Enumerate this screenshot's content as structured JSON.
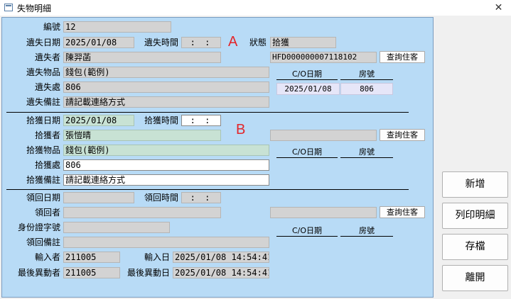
{
  "window": {
    "title": "失物明細",
    "close_glyph": "✕"
  },
  "markers": {
    "a": "A",
    "b": "B"
  },
  "lost": {
    "id_label": "編號",
    "id_value": "12",
    "date_label": "遺失日期",
    "date_value": "2025/01/08",
    "time_label": "遺失時間",
    "time_value": ":  :",
    "status_label": "狀態",
    "status_value": "拾獲",
    "person_label": "遺失者",
    "person_value": "陳羿菡",
    "reg_value": "HFD000000007118102",
    "lookup_label": "查詢住客",
    "item_label": "遺失物品",
    "item_value": "錢包(範例)",
    "place_label": "遺失處",
    "place_value": "806",
    "note_label": "遺失備註",
    "note_value": "請記載連絡方式",
    "table": {
      "col1": "C/O日期",
      "col2": "房號",
      "row_co": "2025/01/08",
      "row_room": "806"
    }
  },
  "found": {
    "date_label": "拾獲日期",
    "date_value": "2025/01/08",
    "time_label": "拾獲時間",
    "time_value": ":  :",
    "person_label": "拾獲者",
    "person_value": "張愷晴",
    "reg_value": "",
    "lookup_label": "查詢住客",
    "item_label": "拾獲物品",
    "item_value": "錢包(範例)",
    "place_label": "拾獲處",
    "place_value": "806",
    "note_label": "拾獲備註",
    "note_value": "請記載連絡方式",
    "table": {
      "col1": "C/O日期",
      "col2": "房號"
    }
  },
  "returned": {
    "date_label": "領回日期",
    "date_value": "",
    "time_label": "領回時間",
    "time_value": ":  :",
    "person_label": "領回者",
    "person_value": "",
    "reg_value": "",
    "lookup_label": "查詢住客",
    "idcard_label": "身份證字號",
    "idcard_value": "",
    "note_label": "領回備註",
    "note_value": "",
    "table": {
      "col1": "C/O日期",
      "col2": "房號"
    }
  },
  "audit": {
    "input_by_label": "輸入者",
    "input_by_value": "211005",
    "input_date_label": "輸入日",
    "input_date_value": "2025/01/08 14:54:41",
    "mod_by_label": "最後異動者",
    "mod_by_value": "211005",
    "mod_date_label": "最後異動日",
    "mod_date_value": "2025/01/08 14:54:41"
  },
  "actions": {
    "add": "新增",
    "print": "列印明細",
    "save": "存檔",
    "exit": "離開"
  }
}
